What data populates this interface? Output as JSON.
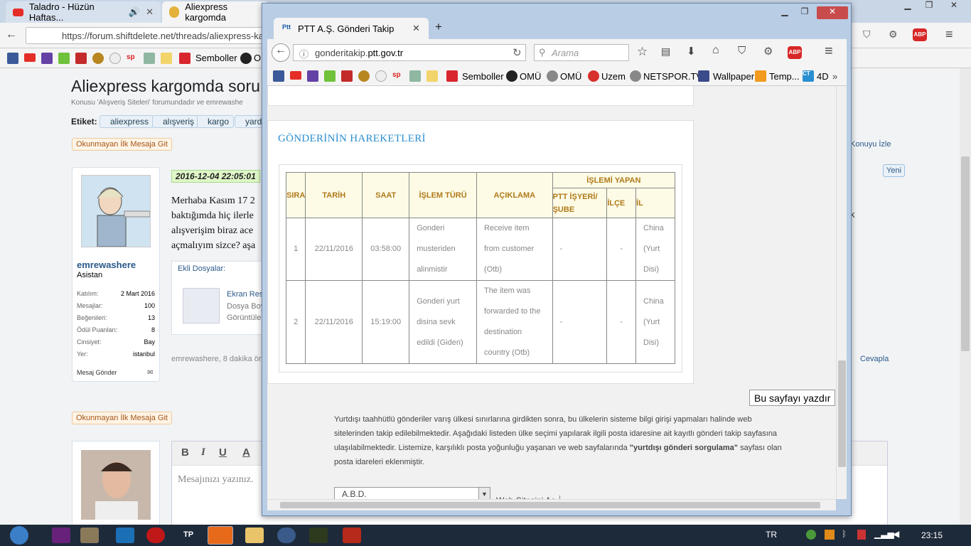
{
  "back_browser": {
    "tabs": [
      {
        "label": "Taladro - Hüzün Haftas..."
      },
      {
        "label": "Aliexpress kargomda"
      }
    ],
    "url": "https://forum.shiftdelete.net/threads/aliexpress-kargo",
    "bookmarks": [
      "Semboller",
      "OM"
    ]
  },
  "forum": {
    "title": "Aliexpress kargomda soru",
    "subtitle": "Konusu 'Alışveriş Siteleri' forumundadır ve emrewashe",
    "tags_label": "Etiket:",
    "tags": [
      "aliexpress",
      "alışveriş",
      "kargo",
      "yard"
    ],
    "unread_btn": "Okunmayan İlk Mesaja Git",
    "user": {
      "name": "emrewashere",
      "title": "Asistan",
      "stats": [
        {
          "label": "Katılım:",
          "value": "2 Mart 2016"
        },
        {
          "label": "Mesajlar:",
          "value": "100"
        },
        {
          "label": "Beğenileri:",
          "value": "13"
        },
        {
          "label": "Ödül Puanları:",
          "value": "8"
        },
        {
          "label": "Cinsiyet:",
          "value": "Bay"
        },
        {
          "label": "Yer:",
          "value": "istanbul"
        }
      ],
      "send_msg": "Mesaj Gönder"
    },
    "post_date": "2016-12-04 22:05:01",
    "post_lines": [
      "Merhaba Kasım 17 2",
      "baktığımda hiç ilerle",
      "alışverişim biraz ace",
      "açmalıyım sizce? aşa"
    ],
    "attachments_label": "Ekli Dosyalar:",
    "attachment_name": "Ekran Res",
    "attachment_size": "Dosya Boy",
    "attachment_view": "Görüntüle",
    "post_meta": "emrewashere, 8 dakika ön",
    "watch": "Konuyu İzle",
    "new_badge": "Yeni",
    "reply": "Cevapla",
    "k": "k",
    "editor_placeholder": "Mesajınızı yazınız."
  },
  "popup": {
    "tab_title": "PTT A.Ş. Gönderi Takip",
    "url_plain": "gonderitakip.",
    "url_domain": "ptt.gov.tr",
    "search_placeholder": "Arama",
    "bookmarks": [
      "Semboller",
      "OMÜ",
      "OMÜ",
      "Uzem",
      "NETSPOR.TV",
      "Wallpaper",
      "Temp...",
      "4D"
    ],
    "section_title": "GÖNDERİNİN HAREKETLERİ",
    "table": {
      "headers": {
        "sira": "SIRA",
        "tarih": "TARİH",
        "saat": "SAAT",
        "islem_turu": "İŞLEM TÜRÜ",
        "aciklama": "AÇIKLAMA",
        "islemi_yapan": "İŞLEMİ YAPAN",
        "ptt_sube": "PTT İŞYERİ/ŞUBE",
        "ilce": "İLÇE",
        "il": "İL"
      },
      "rows": [
        {
          "sira": "1",
          "tarih": "22/11/2016",
          "saat": "03:58:00",
          "islem": "Gonderi musteriden alinmistir",
          "aciklama": "Receive item from customer (Otb)",
          "sube": "-",
          "ilce": "-",
          "il": "China (Yurt Disi)"
        },
        {
          "sira": "2",
          "tarih": "22/11/2016",
          "saat": "15:19:00",
          "islem": "Gonderi yurt disina sevk edildi (Giden)",
          "aciklama": "The item was forwarded to the destination country (Otb)",
          "sube": "-",
          "ilce": "-",
          "il": "China (Yurt Disi)"
        }
      ]
    },
    "print_btn": "Bu sayfayı yazdır",
    "info_pre": "Yurtdışı taahhütlü gönderiler varış ülkesi sınırlarına girdikten sonra, bu ülkelerin sisteme bilgi girişi yapmaları halinde web sitelerinden takip edilebilmektedir. Aşağıdaki listeden ülke seçimi yapılarak ilgili posta idaresine ait kayıtlı gönderi takip  sayfasına ulaşılabilmektedir. Listemize, karşılıklı posta yoğunluğu yaşanan ve web sayfalarında ",
    "info_bold": "\"yurtdışı gönderi sorgulama\"",
    "info_post": " sayfası olan posta idareleri eklenmiştir.",
    "country": "A.B.D.",
    "web_btn": "Web Sitesini Aç"
  },
  "taskbar": {
    "lang": "TR",
    "clock": "23:15",
    "tp": "TP"
  }
}
